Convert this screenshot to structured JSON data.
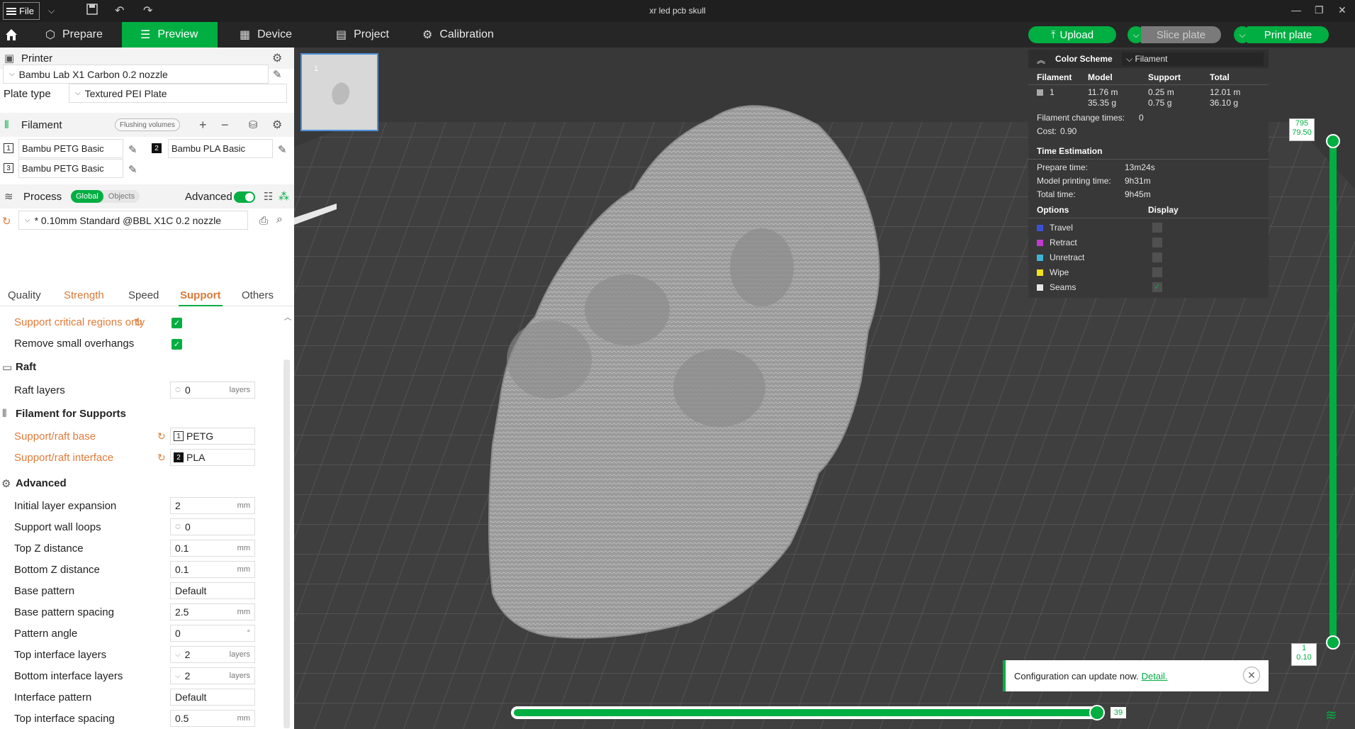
{
  "titlebar": {
    "file_label": "File",
    "title": "xr led pcb skull"
  },
  "nav": {
    "prepare": "Prepare",
    "preview": "Preview",
    "device": "Device",
    "project": "Project",
    "calibration": "Calibration",
    "upload": "Upload",
    "slice_plate": "Slice plate",
    "print_plate": "Print plate"
  },
  "printer": {
    "section_label": "Printer",
    "printer_name": "Bambu Lab X1 Carbon 0.2 nozzle",
    "plate_type_label": "Plate type",
    "plate_type": "Textured PEI Plate"
  },
  "filament": {
    "section_label": "Filament",
    "flushing_label": "Flushing volumes",
    "slots": [
      {
        "num": "1",
        "name": "Bambu PETG Basic"
      },
      {
        "num": "2",
        "name": "Bambu PLA Basic"
      },
      {
        "num": "3",
        "name": "Bambu PETG Basic"
      }
    ]
  },
  "process": {
    "section_label": "Process",
    "global_label": "Global",
    "objects_label": "Objects",
    "advanced_label": "Advanced",
    "preset": "* 0.10mm Standard @BBL X1C 0.2 nozzle"
  },
  "tabs": [
    "Quality",
    "Strength",
    "Speed",
    "Support",
    "Others"
  ],
  "support": {
    "critical_label": "Support critical regions only",
    "remove_small_label": "Remove small overhangs"
  },
  "raft": {
    "group_label": "Raft",
    "layers_label": "Raft layers",
    "layers_value": "0",
    "layers_unit": "layers"
  },
  "filament_supports": {
    "group_label": "Filament for Supports",
    "base_label": "Support/raft base",
    "base_num": "1",
    "base_value": "PETG",
    "interface_label": "Support/raft interface",
    "interface_num": "2",
    "interface_value": "PLA"
  },
  "advanced": {
    "group_label": "Advanced",
    "rows": [
      {
        "label": "Initial layer expansion",
        "value": "2",
        "unit": "mm"
      },
      {
        "label": "Support wall loops",
        "value": "0",
        "unit": ""
      },
      {
        "label": "Top Z distance",
        "value": "0.1",
        "unit": "mm"
      },
      {
        "label": "Bottom Z distance",
        "value": "0.1",
        "unit": "mm"
      },
      {
        "label": "Base pattern",
        "value": "Default",
        "unit": ""
      },
      {
        "label": "Base pattern spacing",
        "value": "2.5",
        "unit": "mm"
      },
      {
        "label": "Pattern angle",
        "value": "0",
        "unit": "°"
      },
      {
        "label": "Top interface layers",
        "value": "2",
        "unit": "layers"
      },
      {
        "label": "Bottom interface layers",
        "value": "2",
        "unit": "layers"
      },
      {
        "label": "Interface pattern",
        "value": "Default",
        "unit": ""
      },
      {
        "label": "Top interface spacing",
        "value": "0.5",
        "unit": "mm"
      }
    ]
  },
  "plate_thumb": {
    "number": "1"
  },
  "legend": {
    "color_scheme_label": "Color Scheme",
    "color_scheme_value": "Filament",
    "headers": [
      "Filament",
      "Model",
      "Support",
      "Total"
    ],
    "row": {
      "num": "1",
      "model_len": "11.76 m",
      "model_wt": "35.35 g",
      "support_len": "0.25 m",
      "support_wt": "0.75 g",
      "total_len": "12.01 m",
      "total_wt": "36.10 g"
    },
    "change_times_label": "Filament change times:",
    "change_times": "0",
    "cost_label": "Cost:",
    "cost": "0.90",
    "time_heading": "Time Estimation",
    "prepare_label": "Prepare time:",
    "prepare_time": "13m24s",
    "model_print_label": "Model printing time:",
    "model_print_time": "9h31m",
    "total_label": "Total time:",
    "total_time": "9h45m",
    "options_label": "Options",
    "display_label": "Display",
    "options": [
      {
        "name": "Travel",
        "color": "#3b4fd6"
      },
      {
        "name": "Retract",
        "color": "#c03ad0"
      },
      {
        "name": "Unretract",
        "color": "#3fb3d8"
      },
      {
        "name": "Wipe",
        "color": "#f2e11a"
      },
      {
        "name": "Seams",
        "color": "#e8e8e8"
      }
    ]
  },
  "vslider": {
    "top_a": "795",
    "top_b": "79.50",
    "bottom_a": "1",
    "bottom_b": "0.10"
  },
  "hslider": {
    "value": "39"
  },
  "notification": {
    "text": "Configuration can update now.",
    "link": "Detail."
  },
  "colors": {
    "accent": "#00ae42",
    "modified": "#e27b3a"
  }
}
